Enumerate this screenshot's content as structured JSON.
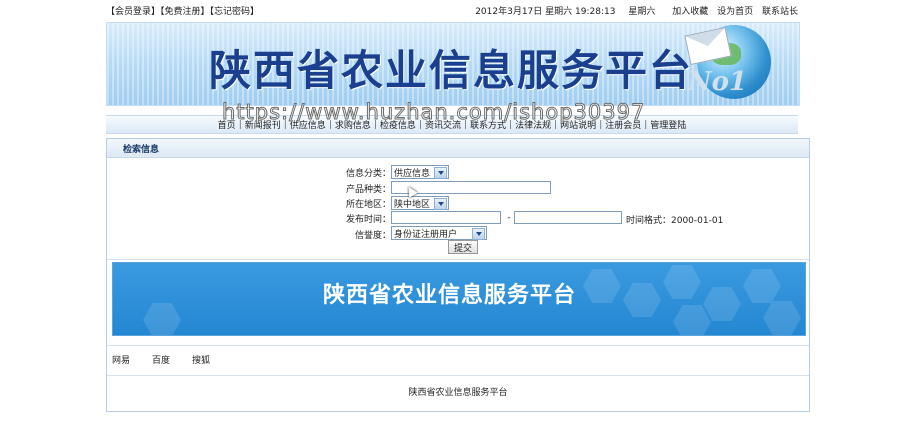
{
  "topbar": {
    "left_links": [
      "【会员登录】",
      "【免费注册】",
      "【忘记密码】"
    ],
    "datetime": "2012年3月17日 星期六 19:28:13",
    "weekday": "星期六",
    "right_links": [
      "加入收藏",
      "设为首页",
      "联系站长"
    ]
  },
  "banner": {
    "title": "陕西省农业信息服务平台",
    "badge": "No1"
  },
  "watermark": "https://www.huzhan.com/ishop30397",
  "nav": {
    "items": [
      "首页",
      "新闻报刊",
      "供应信息",
      "求购信息",
      "检疫信息",
      "资讯交流",
      "联系方式",
      "法律法规",
      "网站说明",
      "注册会员",
      "管理登陆"
    ]
  },
  "search": {
    "heading": "检索信息",
    "category_label": "信息分类：",
    "category_value": "供应信息",
    "product_label": "产品种类：",
    "region_label": "所在地区：",
    "region_value": "陕中地区",
    "date_label": "发布时间：",
    "date_sep": "-",
    "date_hint": "时间格式：2000-01-01",
    "trust_label": "信誉度：",
    "trust_value": "身份证注册用户",
    "submit_label": "提交"
  },
  "ad": {
    "title": "陕西省农业信息服务平台"
  },
  "friend_links": [
    "网易",
    "百度",
    "搜狐"
  ],
  "footer": {
    "text": "陕西省农业信息服务平台"
  },
  "colors": {
    "header_blue": "#1a3f8f",
    "ad_blue": "#2a8ed6",
    "border": "#b7cde4"
  }
}
